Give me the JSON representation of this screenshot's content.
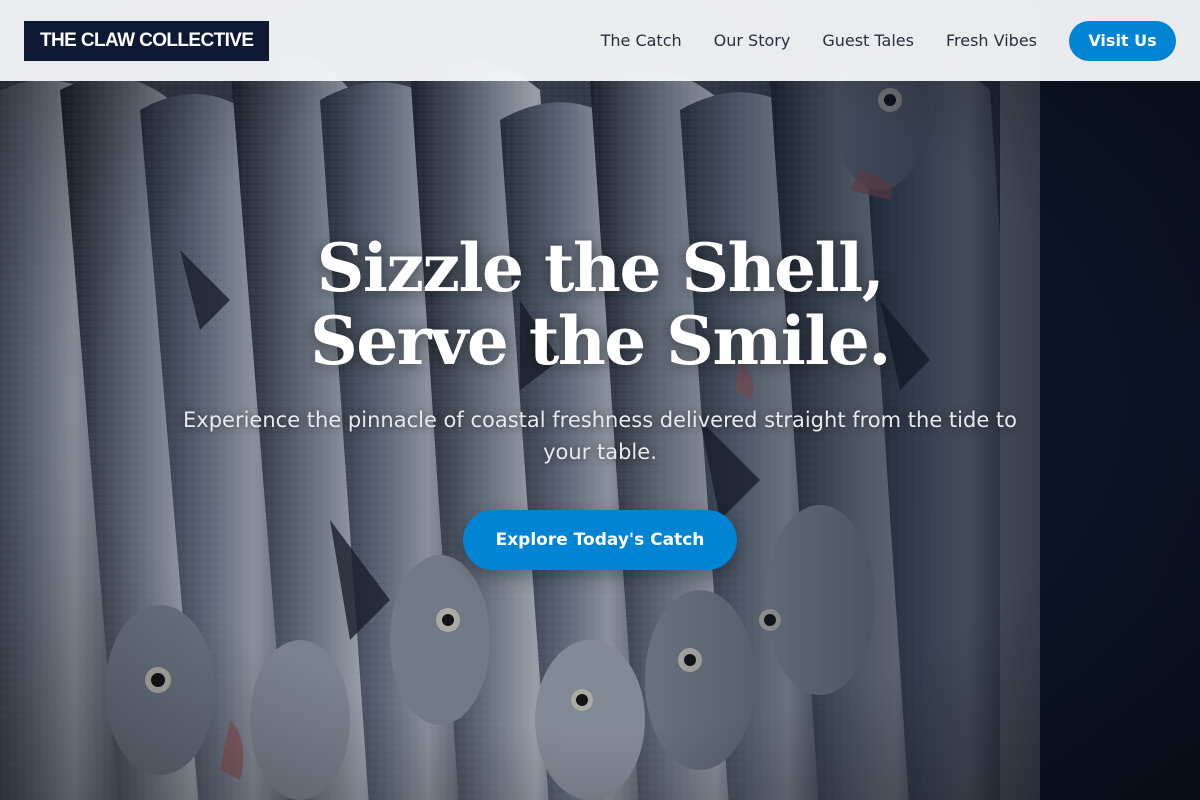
{
  "nav": {
    "logo": "THE CLAW COLLECTIVE",
    "links": [
      {
        "label": "The Catch"
      },
      {
        "label": "Our Story"
      },
      {
        "label": "Guest Tales"
      },
      {
        "label": "Fresh Vibes"
      }
    ],
    "cta_label": "Visit Us"
  },
  "hero": {
    "title_line1": "Sizzle the Shell,",
    "title_line2": "Serve the Smile.",
    "subtitle": "Experience the pinnacle of coastal freshness delivered straight from the tide to your table.",
    "cta_label": "Explore Today's Catch",
    "background_image": "fish-pile-photo"
  },
  "colors": {
    "accent": "#0284d4",
    "logo_bg": "#0e1a33",
    "nav_bg": "#f4f5f7",
    "hero_dark": "#0b1424"
  }
}
